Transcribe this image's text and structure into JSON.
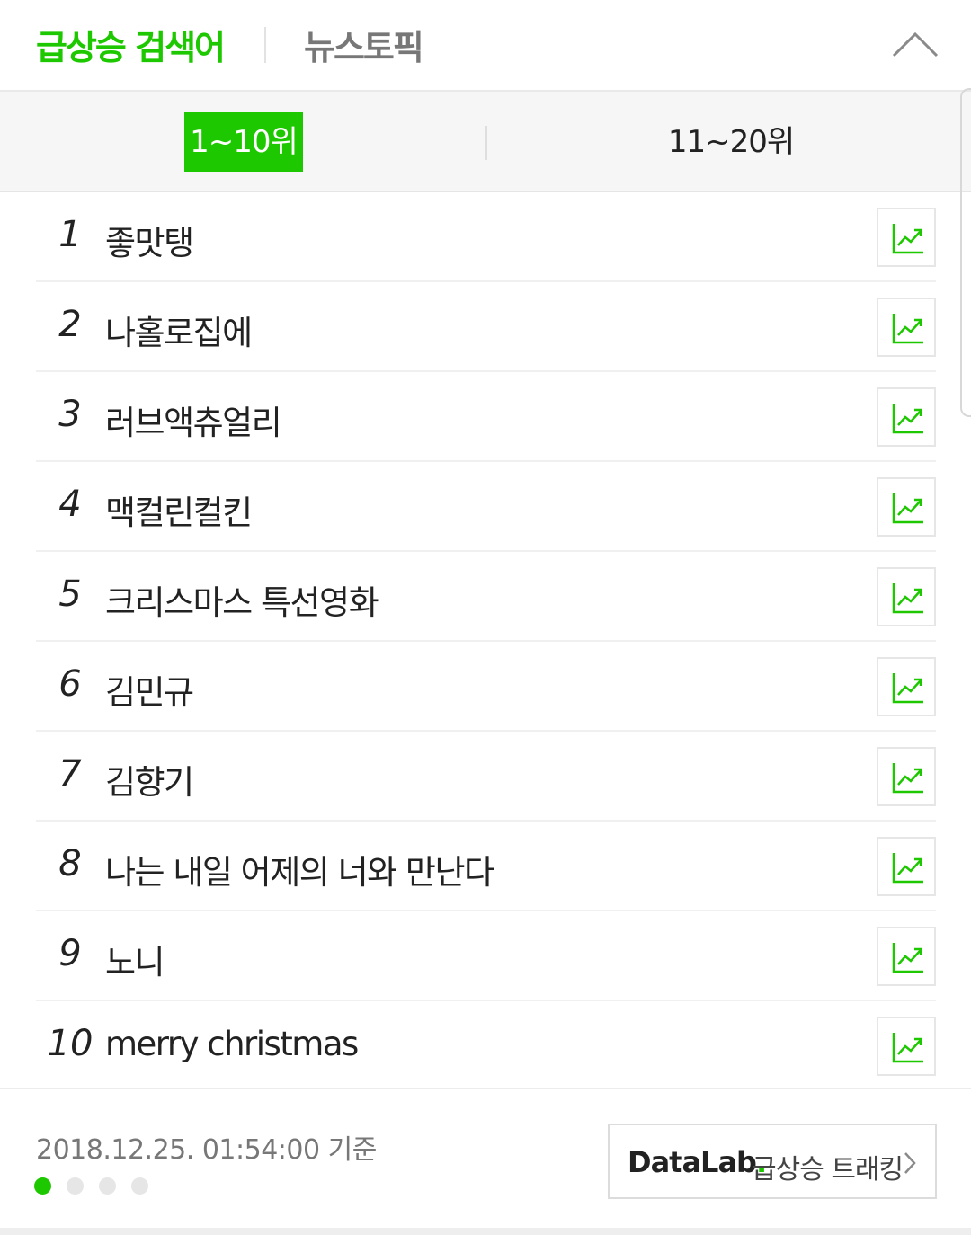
{
  "header": {
    "tab_rising": "급상승 검색어",
    "tab_news": "뉴스토픽",
    "collapse_icon": "chevron-up-icon"
  },
  "range_tabs": {
    "active": "1~10위",
    "inactive": "11~20위"
  },
  "keywords": [
    {
      "rank": "1",
      "text": "좋맛탱"
    },
    {
      "rank": "2",
      "text": "나홀로집에"
    },
    {
      "rank": "3",
      "text": "러브액츄얼리"
    },
    {
      "rank": "4",
      "text": "맥컬린컬킨"
    },
    {
      "rank": "5",
      "text": "크리스마스 특선영화"
    },
    {
      "rank": "6",
      "text": "김민규"
    },
    {
      "rank": "7",
      "text": "김향기"
    },
    {
      "rank": "8",
      "text": "나는 내일 어제의 너와 만난다"
    },
    {
      "rank": "9",
      "text": "노니"
    },
    {
      "rank": "10",
      "text": "merry christmas"
    }
  ],
  "trend_icon": "trend-chart-icon",
  "footer": {
    "timestamp": "2018.12.25. 01:54:00 기준",
    "page_dots": 4,
    "active_dot": 1,
    "datalab_brand": "DataLab",
    "datalab_dot": ".",
    "datalab_label": "급상승 트래킹"
  },
  "colors": {
    "accent": "#1ec800",
    "text": "#222222",
    "muted": "#777777",
    "border": "#e6e6e6"
  }
}
